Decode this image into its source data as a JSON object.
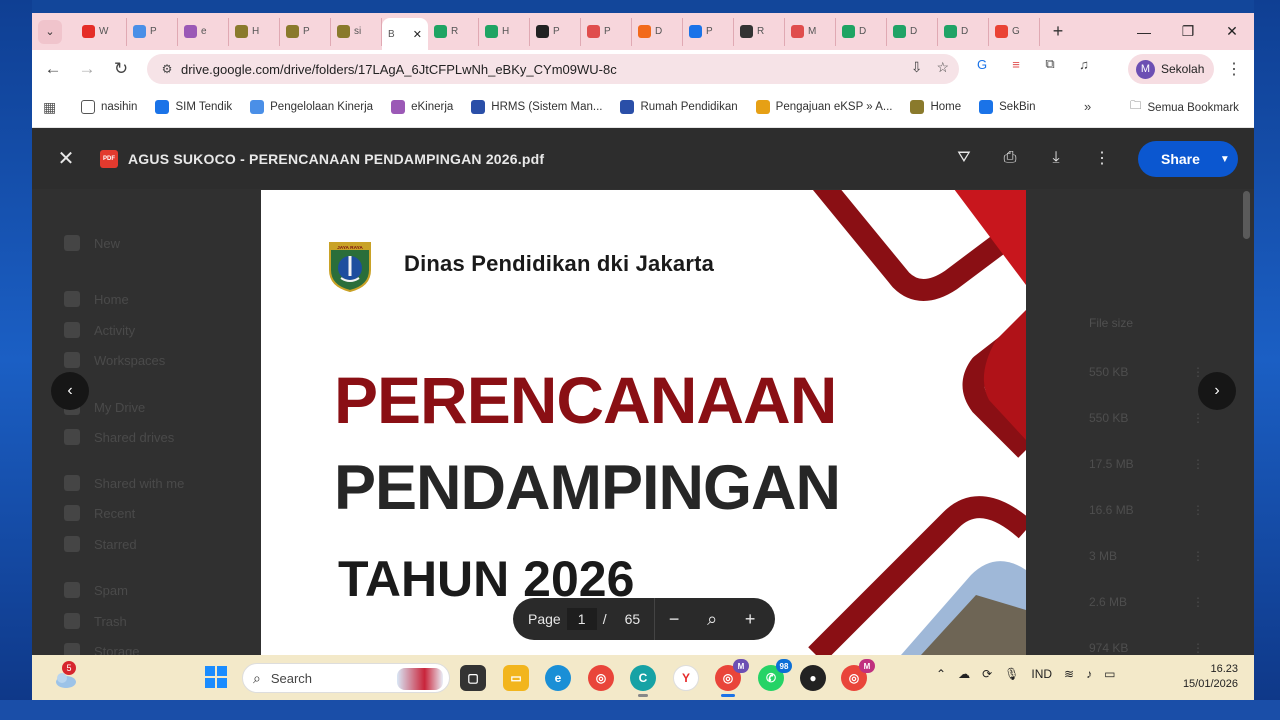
{
  "browser": {
    "tabs": [
      {
        "label": "W",
        "color": "#e52d27"
      },
      {
        "label": "P",
        "color": "#4a8fe7"
      },
      {
        "label": "e",
        "color": "#9b59b6"
      },
      {
        "label": "H",
        "color": "#8a7a2c"
      },
      {
        "label": "P",
        "color": "#8a7a2c"
      },
      {
        "label": "si",
        "color": "#8a7a2c"
      },
      {
        "label": "B",
        "color": "#ffffff"
      },
      {
        "label": "R",
        "color": "#1fa463"
      },
      {
        "label": "H",
        "color": "#1fa463"
      },
      {
        "label": "P",
        "color": "#222222"
      },
      {
        "label": "P",
        "color": "#e04d4d"
      },
      {
        "label": "D",
        "color": "#f26a1b"
      },
      {
        "label": "P",
        "color": "#1a73e8"
      },
      {
        "label": "R",
        "color": "#333333"
      },
      {
        "label": "M",
        "color": "#e04d4d"
      },
      {
        "label": "D",
        "color": "#1fa463"
      },
      {
        "label": "D",
        "color": "#21a366"
      },
      {
        "label": "D",
        "color": "#21a366"
      },
      {
        "label": "G",
        "color": "#ea4335"
      }
    ],
    "active_tab_label": "B",
    "url": "drive.google.com/drive/folders/17LAgA_6JtCFPLwNh_eBKy_CYm09WU-8c",
    "profile_name": "Sekolah",
    "profile_initial": "M",
    "bookmarks": [
      "nasihin",
      "SIM Tendik",
      "Pengelolaan Kinerja",
      "eKinerja",
      "HRMS (Sistem Man...",
      "Rumah Pendidikan",
      "Pengajuan eKSP » A...",
      "Home",
      "SekBin"
    ],
    "all_bookmarks_label": "Semua Bookmark"
  },
  "viewer": {
    "file_badge": "PDF",
    "doc_title": "AGUS SUKOCO - PERENCANAAN PENDAMPINGAN 2026.pdf",
    "share_label": "Share",
    "page_label": "Page",
    "current_page": "1",
    "page_separator": "/",
    "total_pages": "65"
  },
  "pdf": {
    "logo_text": "JAYA RAYA",
    "org_name": "Dinas Pendidikan dki Jakarta",
    "title_line1": "PERENCANAAN",
    "title_line2": "PENDAMPINGAN",
    "title_line3": "TAHUN 2026",
    "accent_color": "#8a0f14"
  },
  "drive_background": {
    "sidebar_items": [
      "New",
      "Home",
      "Activity",
      "Workspaces",
      "My Drive",
      "Shared drives",
      "Shared with me",
      "Recent",
      "Starred",
      "Spam",
      "Trash",
      "Storage"
    ],
    "column_header": "File size",
    "file_sizes": [
      "550 KB",
      "550 KB",
      "17.5 MB",
      "16.6 MB",
      "3 MB",
      "2.6 MB",
      "974 KB"
    ]
  },
  "taskbar": {
    "notification_count": "5",
    "search_placeholder": "Search",
    "whatsapp_badge": "98",
    "chrome_badge": "M",
    "language": "IND",
    "time": "16.23",
    "date": "15/01/2026"
  }
}
